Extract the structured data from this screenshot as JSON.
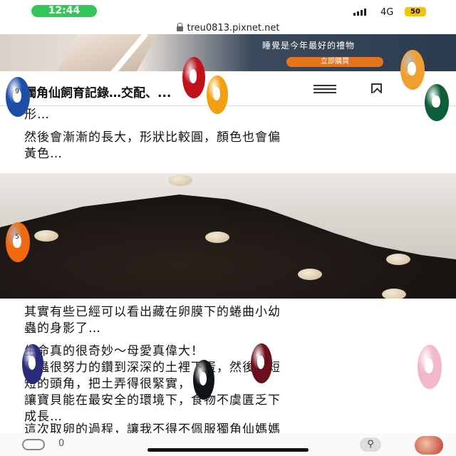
{
  "status_bar": {
    "time": "12:44",
    "network": "4G",
    "battery": "50"
  },
  "browser": {
    "url": "treu0813.pixnet.net"
  },
  "ad": {
    "headline": "睡覺是今年最好的禮物",
    "cta": "立即購買"
  },
  "header": {
    "title": "獨角仙飼育記錄…交配、..."
  },
  "article": {
    "p1": "形…",
    "p2": "然後會漸漸的長大，形狀比較圓，顏色也會偏\n黃色…",
    "p3": "其實有些已經可以看出藏在卵膜下的蜷曲小幼\n蟲的身影了…",
    "p4": "生命真的很奇妙～母愛真偉大！\n母蟲很努力的鑽到深深的土裡下蛋，然後用短\n短的頭角，把土弄得很緊實，\n讓寶貝能在最安全的環境下，食物不虞匱乏下\n成長…",
    "p5": "這次取卵的過程，讓我不得不佩服獨角仙媽媽"
  },
  "footer": {
    "like_count": "0"
  },
  "colors": {
    "accent_green": "#33c759",
    "ad_cta": "#e8741a"
  },
  "icons": [
    "lock-icon",
    "menu-icon",
    "bookmark-icon",
    "like-icon",
    "tool-icon",
    "avatar"
  ],
  "overlay_balls": [
    {
      "name": "billiard-ball-9-blue",
      "color": "#1d4fa8",
      "number": "9"
    },
    {
      "name": "billiard-ball-red",
      "color": "#c0101a",
      "number": ""
    },
    {
      "name": "billiard-ball-orange",
      "color": "#f3a010",
      "number": ""
    },
    {
      "name": "billiard-ball-orange-stripe",
      "color": "#f0a030",
      "number": ""
    },
    {
      "name": "billiard-ball-green",
      "color": "#0d5e3a",
      "number": ""
    },
    {
      "name": "billiard-ball-5-orange",
      "color": "#f26a10",
      "number": "5"
    },
    {
      "name": "billiard-ball-purple",
      "color": "#2c2a7a",
      "number": ""
    },
    {
      "name": "billiard-ball-black",
      "color": "#101418",
      "number": ""
    },
    {
      "name": "billiard-ball-maroon",
      "color": "#6b0f1e",
      "number": ""
    },
    {
      "name": "billiard-ball-pink",
      "color": "#f2b7c8",
      "number": ""
    }
  ]
}
